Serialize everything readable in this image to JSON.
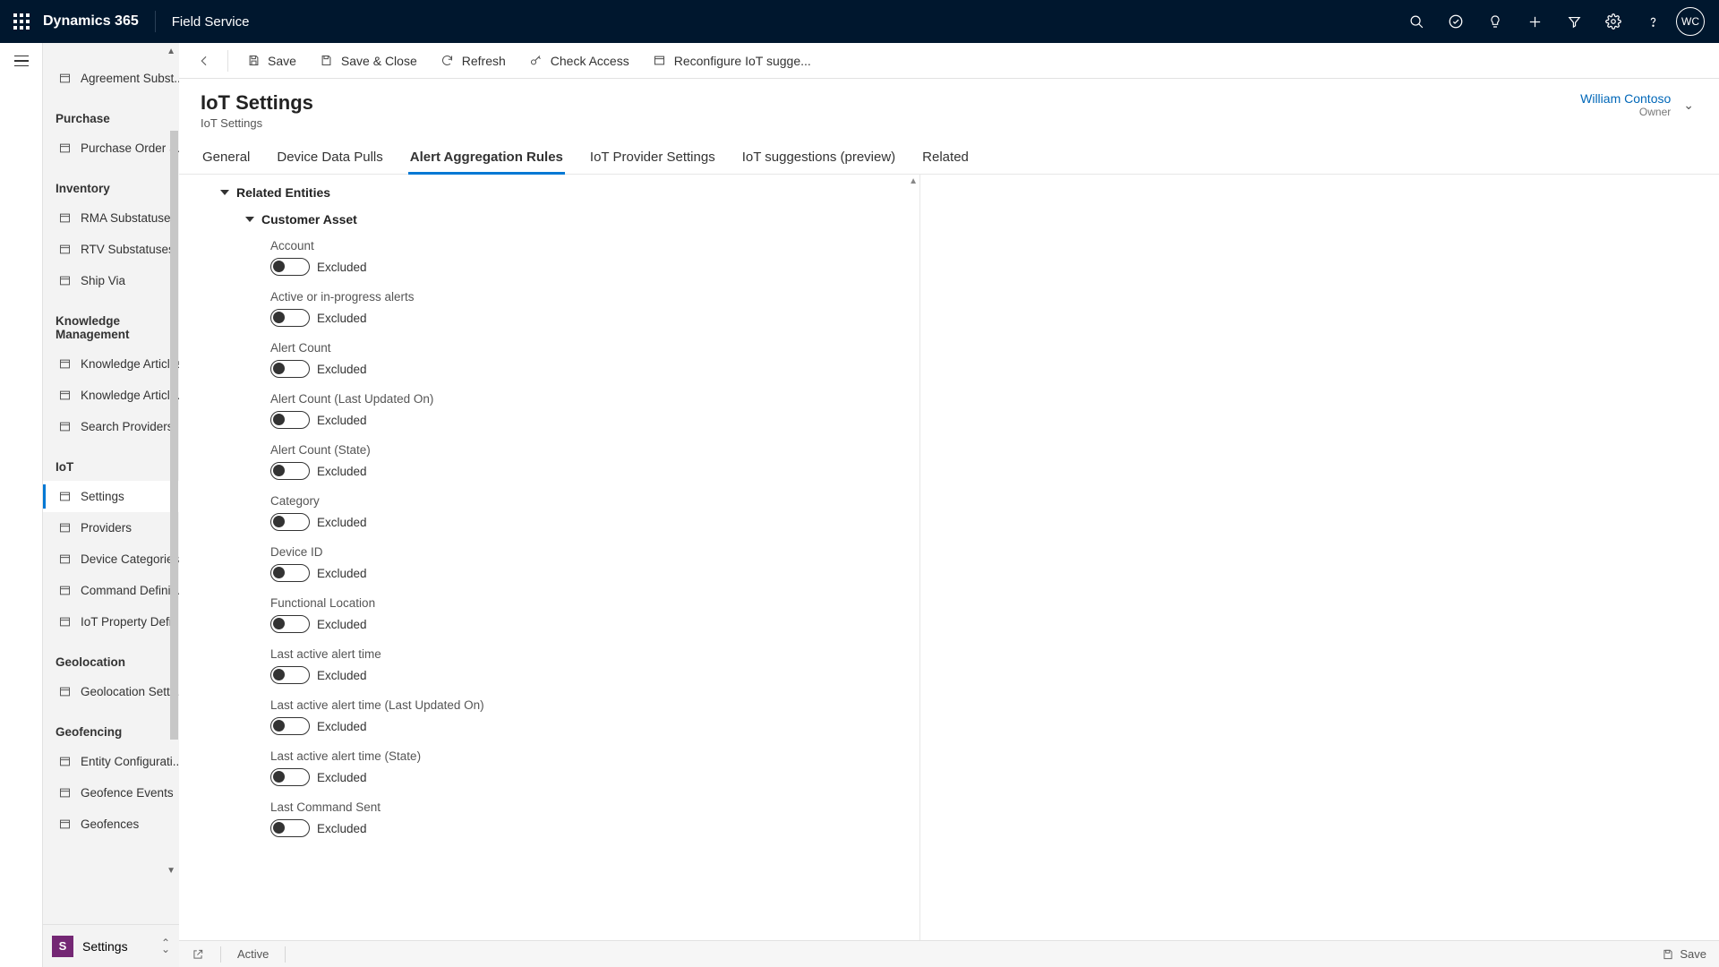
{
  "topbar": {
    "brand": "Dynamics 365",
    "module": "Field Service",
    "avatar_initials": "WC"
  },
  "sidebar": {
    "top_item": "Agreement Subst...",
    "groups": [
      {
        "label": "Purchase",
        "items": [
          "Purchase Order S..."
        ]
      },
      {
        "label": "Inventory",
        "items": [
          "RMA Substatuses",
          "RTV Substatuses",
          "Ship Via"
        ]
      },
      {
        "label": "Knowledge Management",
        "items": [
          "Knowledge Articles",
          "Knowledge Article...",
          "Search Providers"
        ]
      },
      {
        "label": "IoT",
        "items": [
          "Settings",
          "Providers",
          "Device Categories",
          "Command Definiti...",
          "IoT Property Defin..."
        ]
      },
      {
        "label": "Geolocation",
        "items": [
          "Geolocation Setti..."
        ]
      },
      {
        "label": "Geofencing",
        "items": [
          "Entity Configurati...",
          "Geofence Events",
          "Geofences"
        ]
      }
    ],
    "selected": "Settings",
    "footer": {
      "initial": "S",
      "label": "Settings"
    }
  },
  "commands": {
    "save": "Save",
    "save_close": "Save & Close",
    "refresh": "Refresh",
    "check_access": "Check Access",
    "reconfig": "Reconfigure IoT sugge..."
  },
  "header": {
    "title": "IoT Settings",
    "subtitle": "IoT Settings",
    "owner_name": "William Contoso",
    "owner_role": "Owner"
  },
  "tabs": [
    "General",
    "Device Data Pulls",
    "Alert Aggregation Rules",
    "IoT Provider Settings",
    "IoT suggestions (preview)",
    "Related"
  ],
  "active_tab": "Alert Aggregation Rules",
  "form": {
    "section": "Related Entities",
    "subsection": "Customer Asset",
    "fields": [
      {
        "label": "Account",
        "state": "Excluded"
      },
      {
        "label": "Active or in-progress alerts",
        "state": "Excluded"
      },
      {
        "label": "Alert Count",
        "state": "Excluded"
      },
      {
        "label": "Alert Count (Last Updated On)",
        "state": "Excluded"
      },
      {
        "label": "Alert Count (State)",
        "state": "Excluded"
      },
      {
        "label": "Category",
        "state": "Excluded"
      },
      {
        "label": "Device ID",
        "state": "Excluded"
      },
      {
        "label": "Functional Location",
        "state": "Excluded"
      },
      {
        "label": "Last active alert time",
        "state": "Excluded"
      },
      {
        "label": "Last active alert time (Last Updated On)",
        "state": "Excluded"
      },
      {
        "label": "Last active alert time (State)",
        "state": "Excluded"
      },
      {
        "label": "Last Command Sent",
        "state": "Excluded"
      }
    ]
  },
  "statusbar": {
    "status": "Active",
    "save": "Save"
  }
}
